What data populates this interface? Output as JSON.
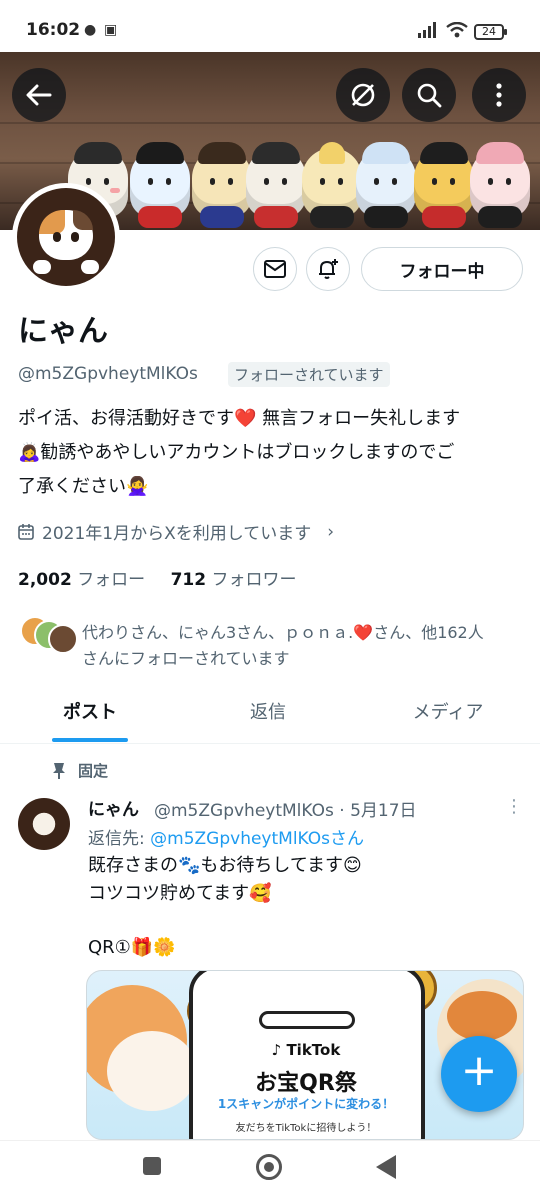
{
  "status_bar": {
    "time": "16:02",
    "battery": "24"
  },
  "profile": {
    "display_name": "にゃん",
    "handle": "@m5ZGpvheytMlKOs",
    "follows_you": "フォローされています",
    "bio_line1": "ポイ活、お得活動好きです❤️ 無言フォロー失礼します",
    "bio_line2": "🙇‍♀️勧誘やあやしいアカウントはブロックしますのでご",
    "bio_line3": "了承ください🙅‍♀️",
    "joined": "2021年1月からXを利用しています",
    "following_count": "2,002",
    "following_label": "フォロー",
    "followers_count": "712",
    "followers_label": "フォロワー",
    "followed_by_line1": "代わりさん、にゃん3さん、ｐｏｎａ.❤️さん、他162人",
    "followed_by_line2": "さんにフォローされています"
  },
  "buttons": {
    "follow": "フォロー中"
  },
  "tabs": [
    {
      "label": "ポスト"
    },
    {
      "label": "返信"
    },
    {
      "label": "メディア"
    }
  ],
  "post": {
    "pinned_label": "固定",
    "author_name": "にゃん",
    "meta": "@m5ZGpvheytMlKOs · 5月17日",
    "reply_prefix": "返信先: ",
    "reply_handle": "@m5ZGpvheytMlKOsさん",
    "line1": "既存さまの🐾もお待ちしてます😊",
    "line2": "コツコツ貯めてます🥰",
    "line3": "QR①🎁🌼",
    "media": {
      "brand": "♪ TikTok",
      "title": "お宝QR祭",
      "subtitle": "1スキャンがポイントに変わる！",
      "caption": "友だちをTikTokに招待しよう！"
    }
  },
  "colors": {
    "accent": "#1d9bf0",
    "text": "#0f1419",
    "muted": "#536471"
  }
}
